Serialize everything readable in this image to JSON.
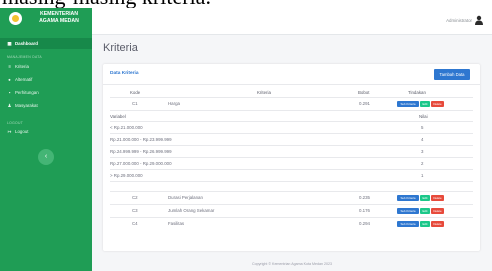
{
  "caption": "masing-masing kriteria.",
  "sidebar": {
    "brand_line1": "KEMENTERIAN",
    "brand_line2": "AGAMA MEDAN",
    "dashboard": "Dashboard",
    "section1": "MANAJEMEN DATA",
    "items": [
      {
        "label": "Kriteria",
        "icon": "list-icon"
      },
      {
        "label": "Alternatif",
        "icon": "users-icon"
      },
      {
        "label": "Perhitungan",
        "icon": "calculator-icon"
      },
      {
        "label": "Masyarakat",
        "icon": "user-icon"
      }
    ],
    "section2": "LOGOUT",
    "logout": "Logout",
    "toggle_icon": "chevron-left-icon"
  },
  "topbar": {
    "admin_name": "Administrator",
    "user_icon": "user-icon"
  },
  "main": {
    "page_title": "Kriteria",
    "card_title": "Data Kriteria",
    "add_button": "Tambah Data",
    "columns": {
      "kode": "Kode",
      "kriteria": "Kriteria",
      "bobot": "Bobot",
      "tindakan": "Tindakan"
    },
    "rows_top": [
      {
        "kode": "C1",
        "kriteria": "Harga",
        "bobot": "0.291"
      }
    ],
    "sub_header": {
      "variabel": "Variabel",
      "nilai": "Nilai"
    },
    "sub_rows": [
      {
        "variabel": "< Rp.21.000.000",
        "nilai": "5"
      },
      {
        "variabel": "Rp.21.000.000 - Rp.23.999.999",
        "nilai": "4"
      },
      {
        "variabel": "Rp.24.999.999 - Rp.26.999.999",
        "nilai": "3"
      },
      {
        "variabel": "Rp.27.000.000 - Rp.29.000.000",
        "nilai": "2"
      },
      {
        "variabel": "> Rp.29.000.000",
        "nilai": "1"
      }
    ],
    "rows_bottom": [
      {
        "kode": "C2",
        "kriteria": "Durasi Perjalanan",
        "bobot": "0.235"
      },
      {
        "kode": "C3",
        "kriteria": "Jumlah Orang Sekamar",
        "bobot": "0.176"
      },
      {
        "kode": "C4",
        "kriteria": "Fasilitas",
        "bobot": "0.294"
      }
    ],
    "action_labels": {
      "sub": "Sub Kriteria",
      "edit": "Edit",
      "delete": "Delete"
    }
  },
  "footer": "Copyright © Kementrian Agama Kota Medan 2023",
  "colors": {
    "sidebar": "#1f9d55",
    "primary": "#2e77d0",
    "success": "#1cc88a",
    "danger": "#e74a3b"
  }
}
